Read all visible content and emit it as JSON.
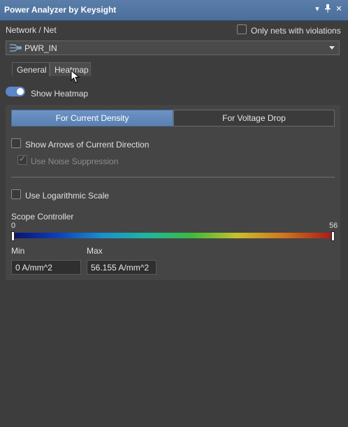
{
  "window": {
    "title": "Power Analyzer by Keysight",
    "buttons": {
      "menu": "▾",
      "pin": "📌",
      "close": "✕"
    }
  },
  "network": {
    "label": "Network / Net",
    "only_violations_label": "Only nets with violations",
    "only_violations_checked": false,
    "selected_net": "PWR_IN"
  },
  "tabs": [
    {
      "label": "General",
      "active": false
    },
    {
      "label": "Heatmap",
      "active": true
    }
  ],
  "heatmap": {
    "show_label": "Show Heatmap",
    "show_enabled": true,
    "modes": [
      {
        "label": "For Current Density",
        "active": true
      },
      {
        "label": "For Voltage Drop",
        "active": false
      }
    ],
    "show_arrows_label": "Show Arrows of Current Direction",
    "show_arrows_checked": false,
    "noise_suppression_label": "Use Noise Suppression",
    "noise_suppression_checked": true,
    "noise_suppression_disabled": true,
    "log_scale_label": "Use Logarithmic Scale",
    "log_scale_checked": false
  },
  "scope": {
    "label": "Scope Controller",
    "range_min": "0",
    "range_max": "56",
    "min_label": "Min",
    "max_label": "Max",
    "min_value": "0 A/mm^2",
    "max_value": "56.155 A/mm^2",
    "handle_min_fraction": 0,
    "handle_max_fraction": 1
  },
  "icons": {
    "net_icon": "net-icon",
    "dropdown_arrow": "chevron-down-icon",
    "cursor": "mouse-pointer-icon"
  },
  "colors": {
    "accent": "#5b86c8",
    "title_bar": "#4b6f9a",
    "background": "#3d3d3d"
  }
}
